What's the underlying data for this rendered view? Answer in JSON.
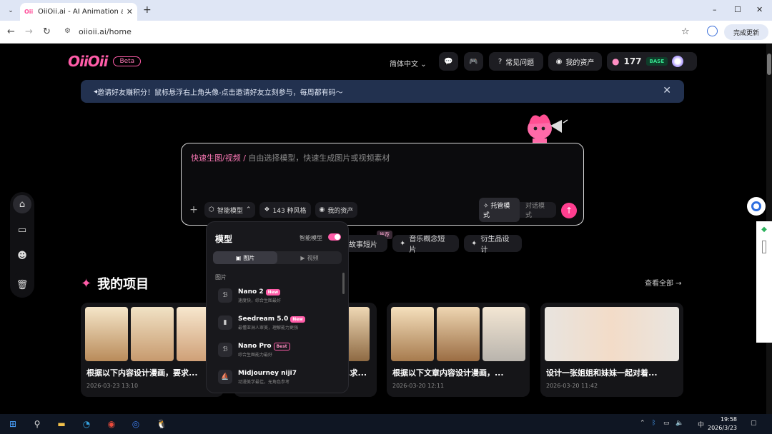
{
  "browser": {
    "tab_title": "OiiOii.ai - AI Animation agen",
    "tab_favicon": "OiiOii",
    "url": "oiioii.ai/home",
    "update_button": "完成更新",
    "win_min": "–",
    "win_max": "☐",
    "win_close": "✕"
  },
  "header": {
    "logo": "OiiOii",
    "beta": "Beta",
    "language": "简体中文",
    "faq": "常见问题",
    "assets": "我的资产",
    "credits": "177",
    "plan": "BASE"
  },
  "banner": {
    "text": "邀请好友赚积分！鼠标悬浮右上角头像-点击邀请好友立刻参与，每周都有码～"
  },
  "prompt": {
    "mode_label": "快速生图/视频 /",
    "placeholder": "自由选择模型，快速生成图片或视频素材",
    "smart_model": "智能模型",
    "styles": "143 种风格",
    "my_assets": "我的资产",
    "managed_mode": "托管模式",
    "chat_mode": "对话模式"
  },
  "quick_actions": [
    {
      "label": "故事短片"
    },
    {
      "label": "音乐概念短片"
    },
    {
      "label": "衍生品设计"
    }
  ],
  "recommend_badge": "推荐",
  "projects": {
    "title": "我的项目",
    "see_all": "查看全部",
    "items": [
      {
        "title": "根据以下内容设计漫画，要求...",
        "date": "2026-03-23 13:10"
      },
      {
        "title": "...求...",
        "date": ""
      },
      {
        "title": "根据以下文章内容设计漫画，...",
        "date": "2026-03-20 12:11"
      },
      {
        "title": "设计一张姐姐和妹妹一起对着...",
        "date": "2026-03-20 11:42"
      }
    ]
  },
  "dropdown": {
    "title": "模型",
    "smart_model": "智能模型",
    "tab_image": "图片",
    "tab_video": "视频",
    "section": "图片",
    "models": [
      {
        "name": "Nano 2",
        "badge": "New",
        "desc": "速度快，综合生图最好"
      },
      {
        "name": "Seedream 5.0",
        "badge": "New",
        "desc": "最懂亚洲人审美，理解能力更强"
      },
      {
        "name": "Nano Pro",
        "badge": "Best",
        "desc": "综合生图能力最好"
      },
      {
        "name": "Midjourney niji7",
        "badge": "",
        "desc": "动漫美学最佳，无角色参考"
      }
    ]
  },
  "taskbar": {
    "time": "19:58",
    "date": "2026/3/23",
    "ime": "中"
  },
  "colors": {
    "accent": "#ff5ca8",
    "banner_bg": "#22314f",
    "send": "#ff3e8f"
  }
}
